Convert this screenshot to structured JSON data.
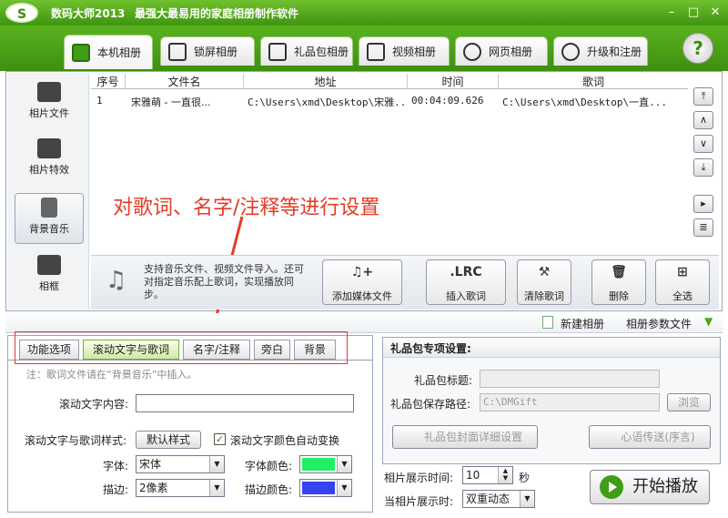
{
  "titlebar": {
    "app_name": "数码大师2013",
    "tagline": "最强大最易用的家庭相册制作软件"
  },
  "tabs": [
    {
      "label": "本机相册",
      "active": true
    },
    {
      "label": "锁屏相册"
    },
    {
      "label": "礼品包相册"
    },
    {
      "label": "视频相册"
    },
    {
      "label": "网页相册"
    },
    {
      "label": "升级和注册"
    }
  ],
  "sidebar": [
    {
      "label": "相片文件"
    },
    {
      "label": "相片特效"
    },
    {
      "label": "背景音乐",
      "active": true
    },
    {
      "label": "相框"
    }
  ],
  "table": {
    "headers": [
      "序号",
      "文件名",
      "地址",
      "时间",
      "歌词"
    ],
    "rows": [
      [
        "1",
        "宋雅萌 - 一直很...",
        "C:\\Users\\xmd\\Desktop\\宋雅...",
        "00:04:09.626",
        "C:\\Users\\xmd\\Desktop\\一直..."
      ]
    ]
  },
  "annotation": "对歌词、名字/注释等进行设置",
  "toolbar": {
    "note": "支持音乐文件、视频文件导入。还可对指定音乐配上歌词，实现播放同步。",
    "buttons": [
      {
        "label": "添加媒体文件",
        "icon": "♫+"
      },
      {
        "label": "插入歌词",
        "icon": ".LRC"
      },
      {
        "label": "清除歌词",
        "icon": "⚒"
      },
      {
        "label": "删除",
        "icon": "🗑"
      },
      {
        "label": "全选",
        "icon": "⊞"
      }
    ]
  },
  "strip": {
    "new_album": "新建相册",
    "album_params": "相册参数文件"
  },
  "left_tabs": [
    {
      "label": "功能选项"
    },
    {
      "label": "滚动文字与歌词",
      "active": true
    },
    {
      "label": "名字/注释"
    },
    {
      "label": "旁白"
    },
    {
      "label": "背景"
    }
  ],
  "left": {
    "note": "注：歌词文件请在“背景音乐”中插入。",
    "scroll_text_label": "滚动文字内容:",
    "scroll_text_value": "",
    "style_label": "滚动文字与歌词样式:",
    "default_style_btn": "默认样式",
    "auto_color_label": "滚动文字颜色自动变换",
    "font_label": "字体:",
    "font_value": "宋体",
    "font_color_label": "字体颜色:",
    "stroke_label": "描边:",
    "stroke_value": "2像素",
    "stroke_color_label": "描边颜色:",
    "font_color": "#22ee66",
    "stroke_color": "#3344ee"
  },
  "right": {
    "title": "礼品包专项设置:",
    "gift_title_label": "礼品包标题:",
    "gift_title_value": "",
    "save_path_label": "礼品包保存路径:",
    "save_path_value": "C:\\DMGift",
    "browse": "浏览",
    "cover_btn": "礼品包封面详细设置",
    "message_btn": "心语传送(序言)"
  },
  "bottom": {
    "display_time_label": "相片展示时间:",
    "display_time_value": "10",
    "unit": "秒",
    "display_mode_label": "当相片展示时:",
    "display_mode_value": "双重动态",
    "start_btn": "开始播放"
  },
  "colors": {
    "brand": "#4fa51a",
    "annotation": "#e53b25"
  }
}
